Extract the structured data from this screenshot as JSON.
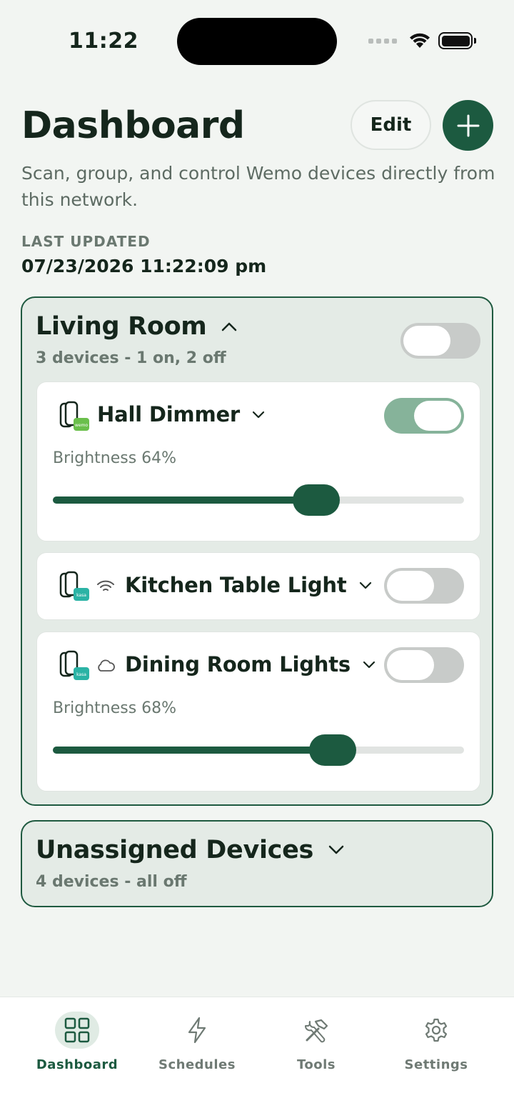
{
  "status_bar": {
    "time": "11:22"
  },
  "header": {
    "title": "Dashboard",
    "edit_label": "Edit",
    "add_icon": "plus-icon",
    "subtitle": "Scan, group, and control Wemo devices directly from this network.",
    "last_updated_label": "LAST UPDATED",
    "last_updated_value": "07/23/2026 11:22:09 pm"
  },
  "groups": [
    {
      "name": "Living Room",
      "summary": "3 devices - 1 on, 2 off",
      "expanded": true,
      "toggle_on": false,
      "devices": [
        {
          "name": "Hall Dimmer",
          "brand": "wemo",
          "connection_icon": "",
          "on": true,
          "brightness_label": "Brightness 64%",
          "brightness": 64
        },
        {
          "name": "Kitchen Table Light",
          "brand": "kasa",
          "connection_icon": "wifi-icon",
          "on": false
        },
        {
          "name": "Dining Room Lights",
          "brand": "kasa",
          "connection_icon": "cloud-icon",
          "on": false,
          "brightness_label": "Brightness 68%",
          "brightness": 68
        }
      ]
    },
    {
      "name": "Unassigned Devices",
      "summary": "4 devices - all off",
      "expanded": false
    }
  ],
  "tabs": [
    {
      "label": "Dashboard",
      "icon": "grid-icon",
      "active": true
    },
    {
      "label": "Schedules",
      "icon": "lightning-icon",
      "active": false
    },
    {
      "label": "Tools",
      "icon": "tools-icon",
      "active": false
    },
    {
      "label": "Settings",
      "icon": "gear-icon",
      "active": false
    }
  ],
  "colors": {
    "accent": "#1c5a40",
    "toggle_on": "#86b39a",
    "toggle_off": "#c8cbc9",
    "wemo_badge": "#6abf4b",
    "kasa_badge": "#2bb3a5"
  }
}
